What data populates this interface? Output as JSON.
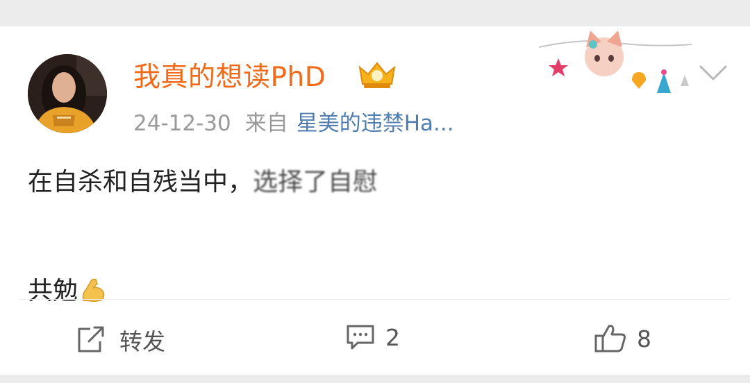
{
  "post": {
    "username": "我真的想读PhD",
    "date": "24-12-30",
    "source_prefix": "来自",
    "source_device": "星美的违禁Ha...",
    "text_line1_clear": "在自杀和自残当中，",
    "text_line1_blurred": "选择了自慰",
    "text_line2": "共勉",
    "icons": {
      "verified": "crown-badge-icon",
      "muscle": "flexed-biceps-emoji",
      "more": "chevron-down-icon"
    }
  },
  "actions": {
    "repost_label": "转发",
    "comment_count": "2",
    "like_count": "8"
  },
  "colors": {
    "username": "#f06a1a",
    "meta": "#9a9a9a",
    "device_link": "#507daf",
    "text": "#222222"
  }
}
